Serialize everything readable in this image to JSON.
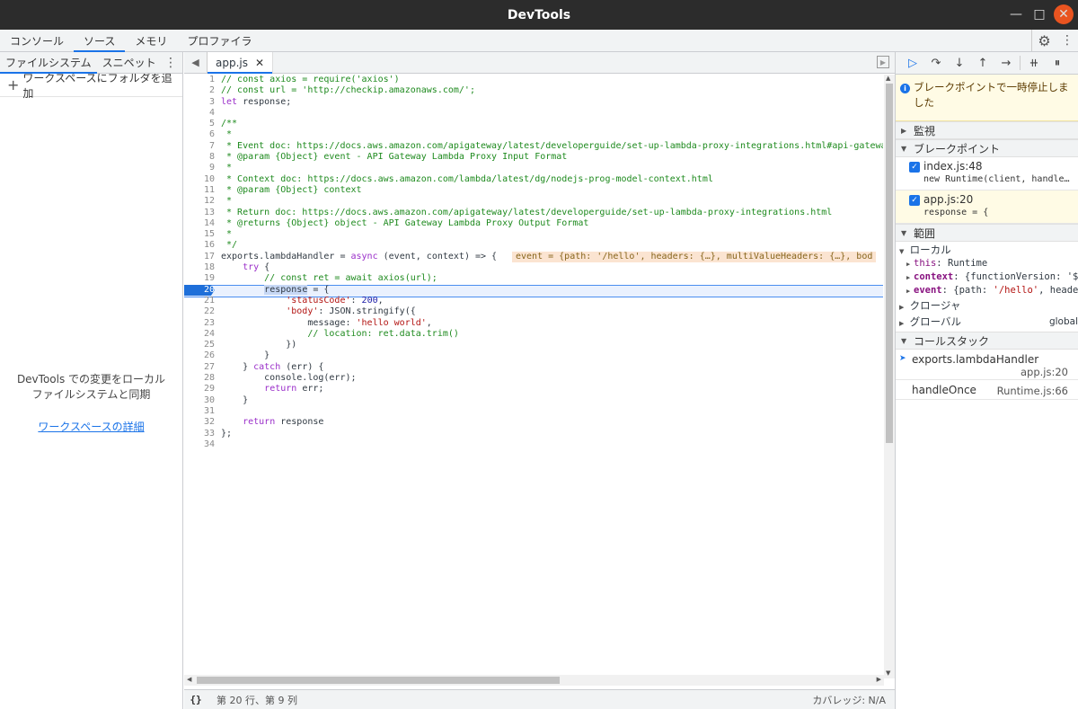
{
  "window": {
    "title": "DevTools"
  },
  "main_tabs": [
    "コンソール",
    "ソース",
    "メモリ",
    "プロファイラ"
  ],
  "left_panel": {
    "tabs": [
      "ファイルシステム",
      "スニペット"
    ],
    "add_folder_label": "ワークスペースにフォルダを追加",
    "message_line1": "DevTools での変更をローカル",
    "message_line2": "ファイルシステムと同期",
    "link_label": "ワークスペースの詳細"
  },
  "editor": {
    "file_tab": "app.js",
    "inline_value": "event = {path: '/hello', headers: {…}, multiValueHeaders: {…}, bod",
    "current_line": 20
  },
  "status_bar": {
    "braces": "{}",
    "position": "第 20 行、第 9 列",
    "coverage": "カバレッジ: N/A"
  },
  "debugger": {
    "paused_message": "ブレークポイントで一時停止しました",
    "sections": {
      "watch": "監視",
      "breakpoints": "ブレークポイント",
      "scope": "範囲",
      "callstack": "コールスタック"
    },
    "breakpoints": [
      {
        "file": "index.js:48",
        "code": "new Runtime(client, handle…"
      },
      {
        "file": "app.js:20",
        "code": "response = {"
      }
    ],
    "scope": {
      "local_label": "ローカル",
      "this_key": "this",
      "this_val": "Runtime",
      "context_key": "context",
      "context_val": "{functionVersion: '$L",
      "event_key": "event",
      "event_val_pre": "{path: ",
      "event_val_str": "'/hello'",
      "event_val_post": ", header",
      "closure_label": "クロージャ",
      "global_label": "グローバル",
      "global_val": "global"
    },
    "callstack": [
      {
        "fn": "exports.lambdaHandler",
        "loc": "app.js:20"
      },
      {
        "fn": "handleOnce",
        "loc": "Runtime.js:66"
      }
    ]
  },
  "colors": {
    "accent": "#1a73e8",
    "close_button": "#e95420",
    "paused_bg": "#fffbe5"
  },
  "icons": [
    "minimize-icon",
    "maximize-icon",
    "close-icon",
    "gear-icon",
    "kebab-icon",
    "plus-icon",
    "resume-icon",
    "step-over-icon",
    "step-into-icon",
    "step-out-icon",
    "step-icon",
    "deactivate-breakpoints-icon",
    "pause-on-exceptions-icon",
    "info-icon"
  ]
}
